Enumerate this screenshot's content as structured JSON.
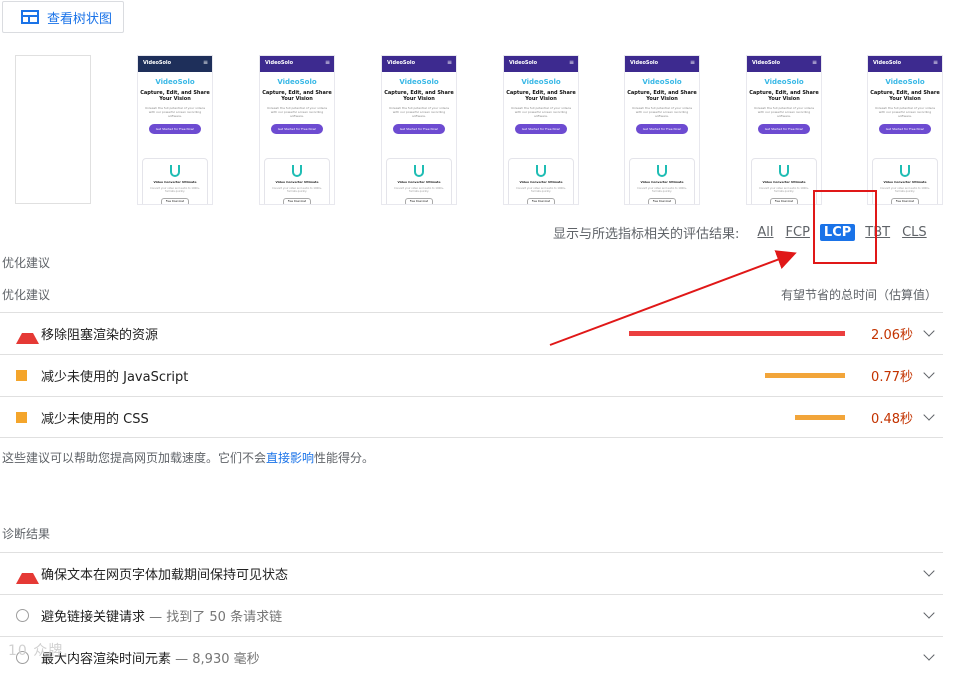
{
  "toolbar": {
    "view_tree_label": "查看树状图"
  },
  "filmstrip": {
    "thumbnail": {
      "logo": "VideoSolo",
      "brand": "VideoSolo",
      "headline_line1": "Capture, Edit, and Share",
      "headline_line2": "Your Vision",
      "sub": "Unleash the full potential of your videos with our powerful screen recording software.",
      "cta": "Get Started for Free Now!",
      "card_title": "Video Converter Ultimate",
      "card_text": "Convert your video and audio to 1000+ formats quickly.",
      "download": "Free Download"
    }
  },
  "metric_filter": {
    "label": "显示与所选指标相关的评估结果:",
    "options": [
      "All",
      "FCP",
      "LCP",
      "TBT",
      "CLS"
    ],
    "active": "LCP"
  },
  "opportunities": {
    "section_label": "优化建议",
    "column_left": "优化建议",
    "column_right": "有望节省的总时间（估算值）",
    "items": [
      {
        "title": "移除阻塞渲染的资源",
        "value": "2.06秒",
        "severity": "fail",
        "fraction": 1.0,
        "bar_color": "#eb3f3f"
      },
      {
        "title": "减少未使用的 JavaScript",
        "value": "0.77秒",
        "severity": "average",
        "fraction": 0.37,
        "bar_color": "#f2a53a"
      },
      {
        "title": "减少未使用的 CSS",
        "value": "0.48秒",
        "severity": "average",
        "fraction": 0.23,
        "bar_color": "#f2a53a"
      }
    ],
    "footnote_prefix": "这些建议可以帮助您提高网页加载速度。它们不会",
    "footnote_link": "直接影响",
    "footnote_suffix": "性能得分。"
  },
  "diagnostics": {
    "section_label": "诊断结果",
    "items": [
      {
        "title": "确保文本在网页字体加载期间保持可见状态",
        "detail": "",
        "severity": "fail"
      },
      {
        "title": "避免链接关键请求",
        "detail": " — 找到了 50 条请求链",
        "severity": "info"
      },
      {
        "title": "最大内容渲染时间元素",
        "detail": " — 8,930 毫秒",
        "severity": "info"
      }
    ]
  },
  "colors": {
    "accent": "#1a73e8",
    "fail": "#e53935",
    "average": "#f4a52b",
    "value": "#c33300",
    "annotation": "#e01818"
  },
  "watermark": "10 众牌..."
}
